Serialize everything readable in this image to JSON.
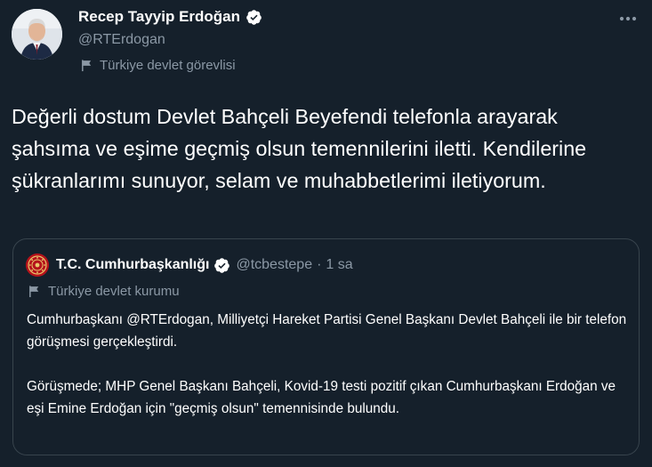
{
  "author": {
    "name": "Recep Tayyip Erdoğan",
    "handle": "@RTErdogan",
    "label": "Türkiye devlet görevlisi",
    "avatar_icon": "profile-photo",
    "verified_icon": "verified-badge-icon"
  },
  "more_icon": "more-icon",
  "tweet": {
    "text": "Değerli dostum Devlet Bahçeli Beyefendi telefonla arayarak şahsıma ve eşime geçmiş olsun temennilerini iletti. Kendilerine şükranlarımı sunuyor, selam ve muhabbetlerimi iletiyorum."
  },
  "quote": {
    "name": "T.C. Cumhurbaşkanlığı",
    "handle": "@tcbestepe",
    "separator": "·",
    "time": "1 sa",
    "label": "Türkiye devlet kurumu",
    "paragraphs": [
      "Cumhurbaşkanı @RTErdogan, Milliyetçi Hareket Partisi Genel Başkanı Devlet Bahçeli ile bir telefon görüşmesi gerçekleştirdi.",
      "Görüşmede; MHP Genel Başkanı Bahçeli, Kovid-19 testi pozitif çıkan Cumhurbaşkanı Erdoğan ve eşi Emine Erdoğan için \"geçmiş olsun\" temennisinde bulundu."
    ]
  },
  "colors": {
    "background": "#15202b",
    "text": "#ffffff",
    "secondary_text": "#8b98a5",
    "border": "#38444d",
    "verified": "#ffffff"
  }
}
